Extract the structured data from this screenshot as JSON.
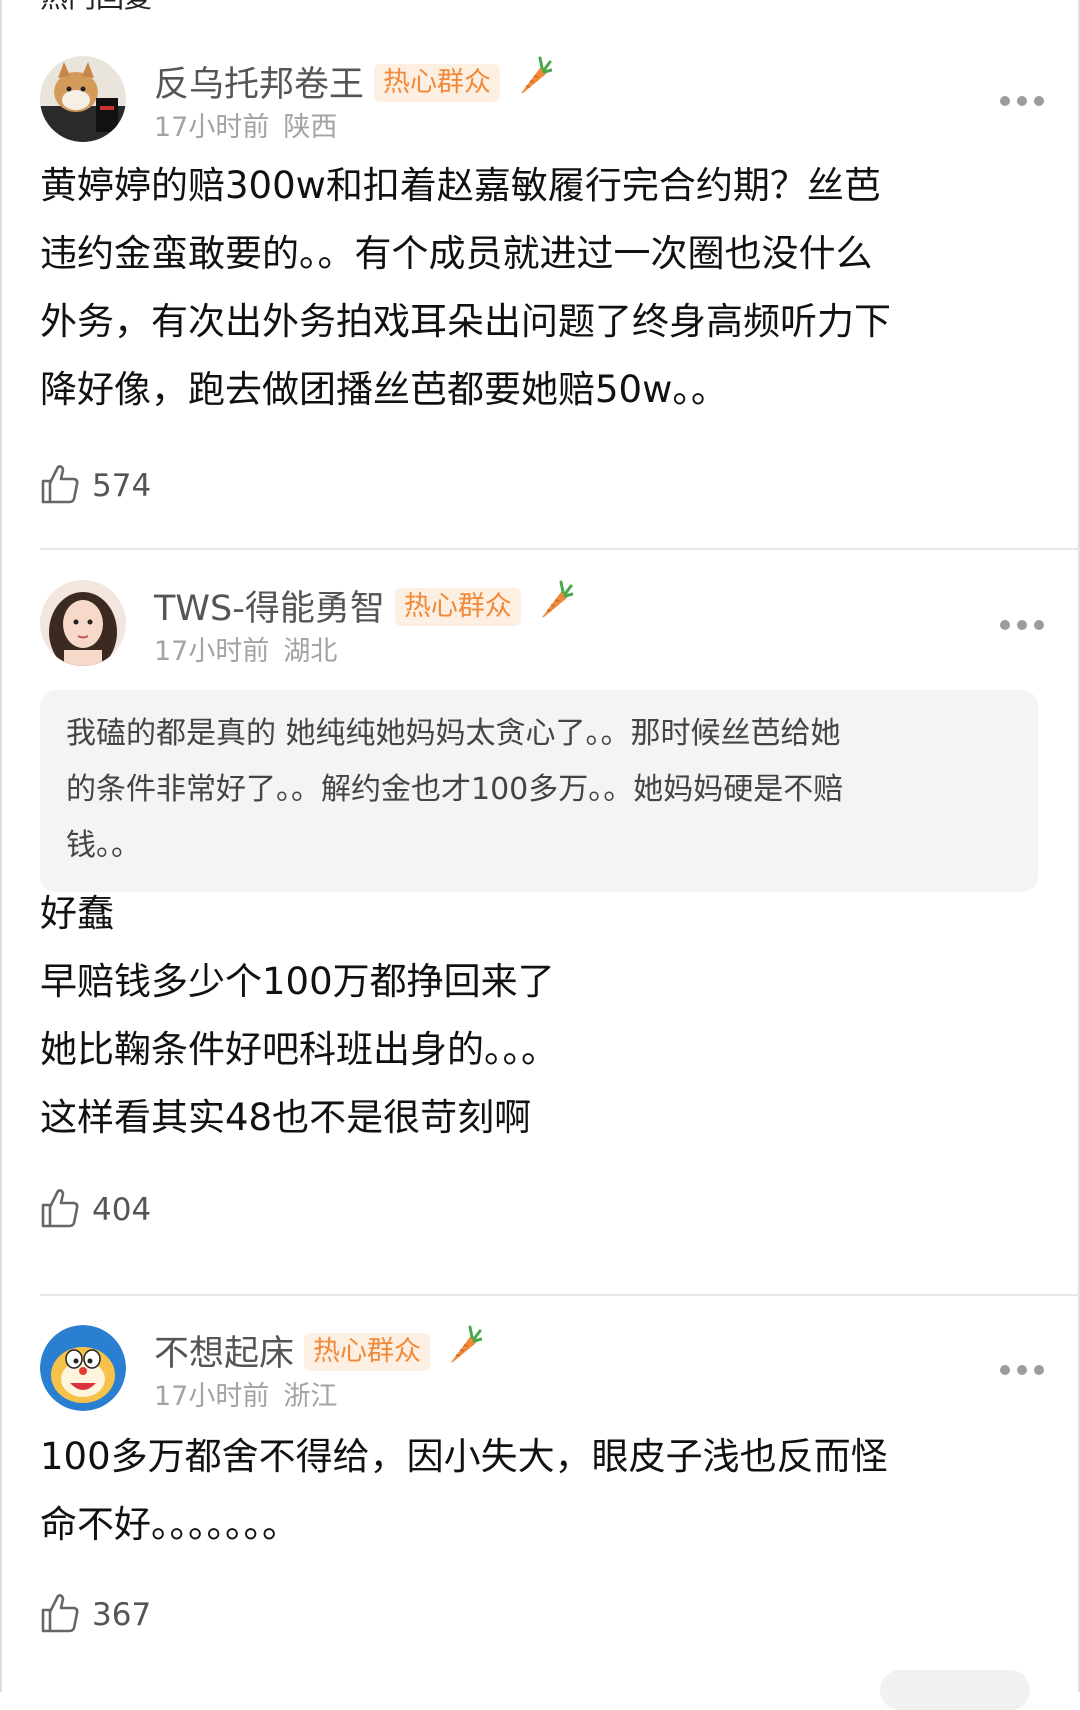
{
  "section": {
    "title": "热门回复"
  },
  "comments": [
    {
      "username": "反乌托邦卷王",
      "badge": "热心群众",
      "time": "17小时前",
      "location": "陕西",
      "lines": [
        "黄婷婷的赔300w和扣着赵嘉敏履行完合约期？丝芭",
        "违约金蛮敢要的。。有个成员就进过一次圈也没什么",
        "外务，有次出外务拍戏耳朵出问题了终身高频听力下",
        "降好像，跑去做团播丝芭都要她赔50w。。"
      ],
      "likes": "574"
    },
    {
      "username": "TWS-得能勇智",
      "badge": "热心群众",
      "time": "17小时前",
      "location": "湖北",
      "quote_lines": [
        "我磕的都是真的 她纯纯她妈妈太贪心了。。那时候丝芭给她",
        "的条件非常好了。。解约金也才100多万。。她妈妈硬是不赔",
        "钱。。"
      ],
      "lines": [
        "好蠢",
        "早赔钱多少个100万都挣回来了",
        "她比鞠条件好吧科班出身的。。。",
        "这样看其实48也不是很苛刻啊"
      ],
      "likes": "404"
    },
    {
      "username": "不想起床",
      "badge": "热心群众",
      "time": "17小时前",
      "location": "浙江",
      "lines": [
        "100多万都舍不得给，因小失大，眼皮子浅也反而怪",
        "命不好。。。。。。。"
      ],
      "likes": "367"
    }
  ],
  "colors": {
    "badge_text": "#f08a3a",
    "badge_bg": "#fdf0e3",
    "meta": "#a3a3a3"
  },
  "icons": {
    "like": "thumbs-up-icon",
    "more": "more-dots-icon",
    "carrot": "carrot-icon"
  }
}
